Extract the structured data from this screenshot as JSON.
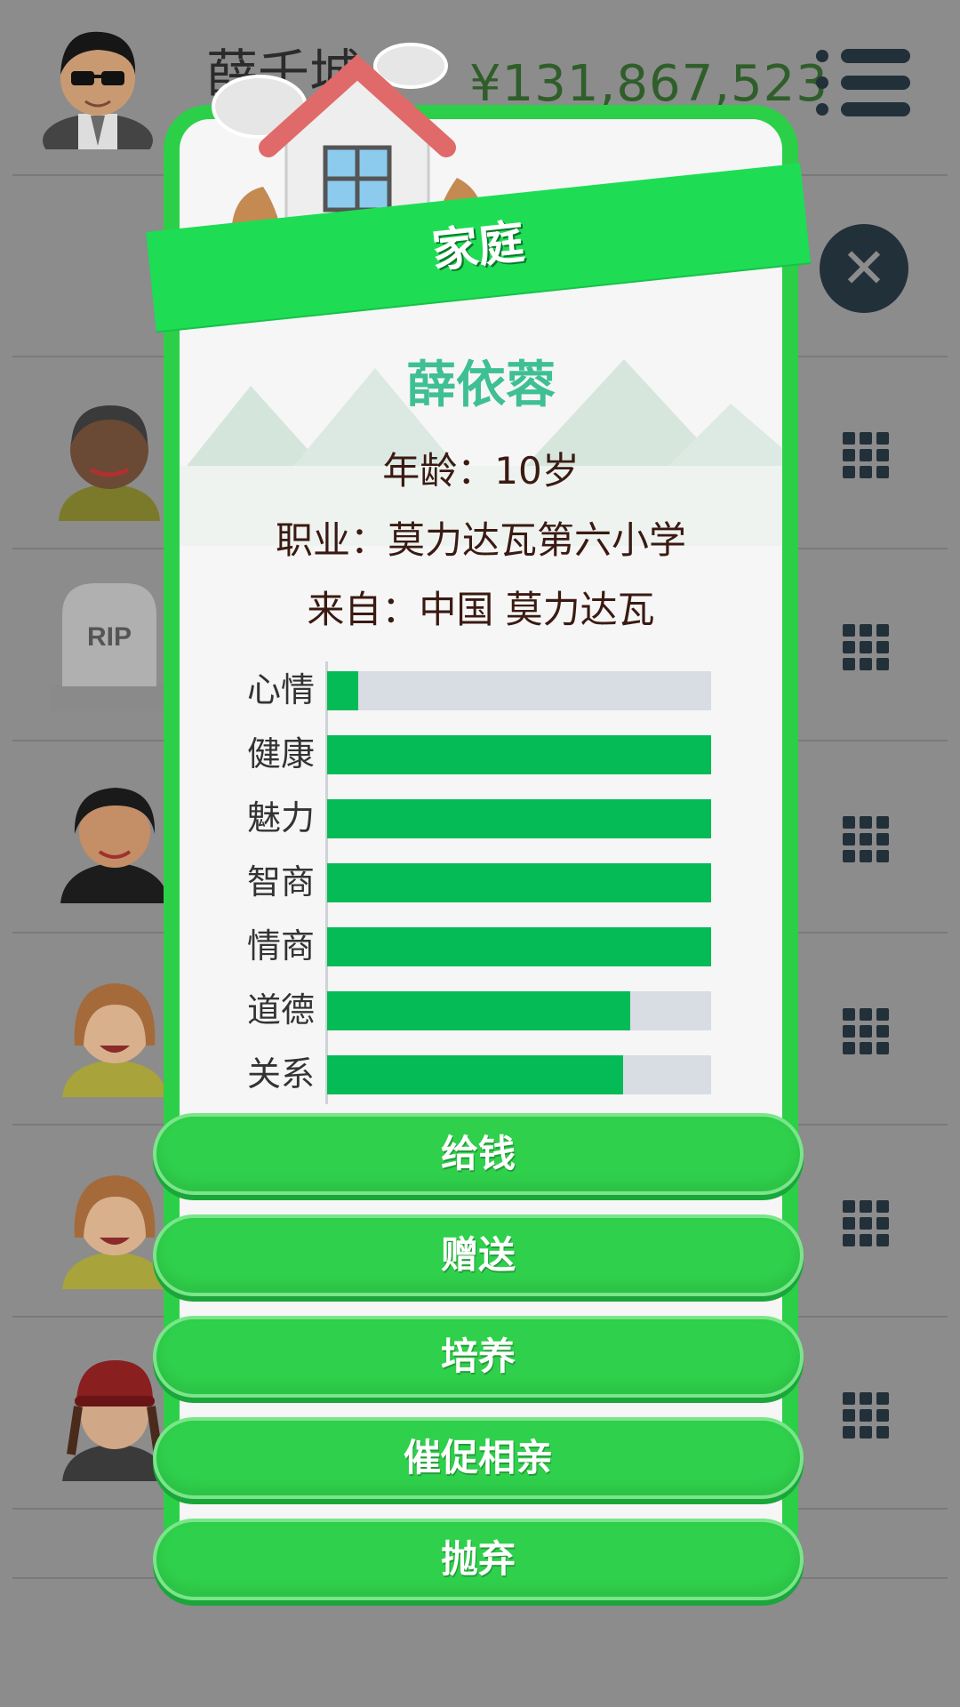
{
  "header": {
    "player_name": "薛千城",
    "money": "¥131,867,523"
  },
  "icons": {
    "menu": "hamburger-menu-icon",
    "close": "close-icon",
    "row_action": "grid-dots-icon"
  },
  "family_rows": [
    {
      "avatar": "man-curly-hair"
    },
    {
      "avatar": "gravestone",
      "rip_text": "RIP"
    },
    {
      "avatar": "woman-dark-hair"
    },
    {
      "avatar": "girl-orange-hair"
    },
    {
      "avatar": "girl-orange-hair-2"
    },
    {
      "avatar": "girl-red-hat"
    }
  ],
  "modal": {
    "title": "家庭",
    "name": "薛依蓉",
    "age_label": "年龄：",
    "age_value": "10岁",
    "job_label": "职业：",
    "job_value": "莫力达瓦第六小学",
    "from_label": "来自：",
    "from_value": "中国 莫力达瓦",
    "stats": [
      {
        "label": "心情",
        "value": 0.08
      },
      {
        "label": "健康",
        "value": 1.0
      },
      {
        "label": "魅力",
        "value": 1.0
      },
      {
        "label": "智商",
        "value": 1.0
      },
      {
        "label": "情商",
        "value": 1.0
      },
      {
        "label": "道德",
        "value": 0.79
      },
      {
        "label": "关系",
        "value": 0.77
      }
    ],
    "buttons": [
      "给钱",
      "赠送",
      "培养",
      "催促相亲",
      "抛弃"
    ]
  },
  "colors": {
    "accent_green": "#2bd048",
    "stat_fill": "#05bb56",
    "name_teal": "#3fbf94"
  }
}
